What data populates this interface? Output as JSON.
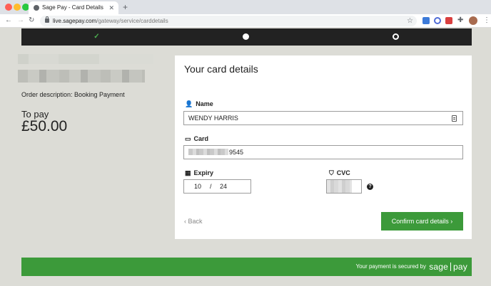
{
  "browser": {
    "tab_title": "Sage Pay - Card Details",
    "tab_close": "✕",
    "new_tab": "+",
    "url_host": "live.sagepay.com",
    "url_path": "/gateway/service/carddetails"
  },
  "progress": {
    "steps": [
      {
        "state": "complete",
        "glyph": "✓"
      },
      {
        "state": "current"
      },
      {
        "state": "upcoming"
      }
    ]
  },
  "summary": {
    "order_description": "Order description: Booking Payment",
    "to_pay_label": "To pay",
    "amount": "£50.00"
  },
  "form": {
    "title": "Your card details",
    "name_label": "Name",
    "name_value": "WENDY HARRIS",
    "card_label": "Card",
    "card_last_digits": "9545",
    "expiry_label": "Expiry",
    "expiry_month": "10",
    "expiry_separator": "/",
    "expiry_year": "24",
    "cvc_label": "CVC",
    "help_glyph": "?",
    "back_label": "Back",
    "confirm_label": "Confirm card details"
  },
  "footer": {
    "secured_text": "Your payment is secured by",
    "brand_left": "sage",
    "brand_right": "pay"
  },
  "colors": {
    "accent_green": "#3c9a3a",
    "progress_bar": "#222222"
  }
}
